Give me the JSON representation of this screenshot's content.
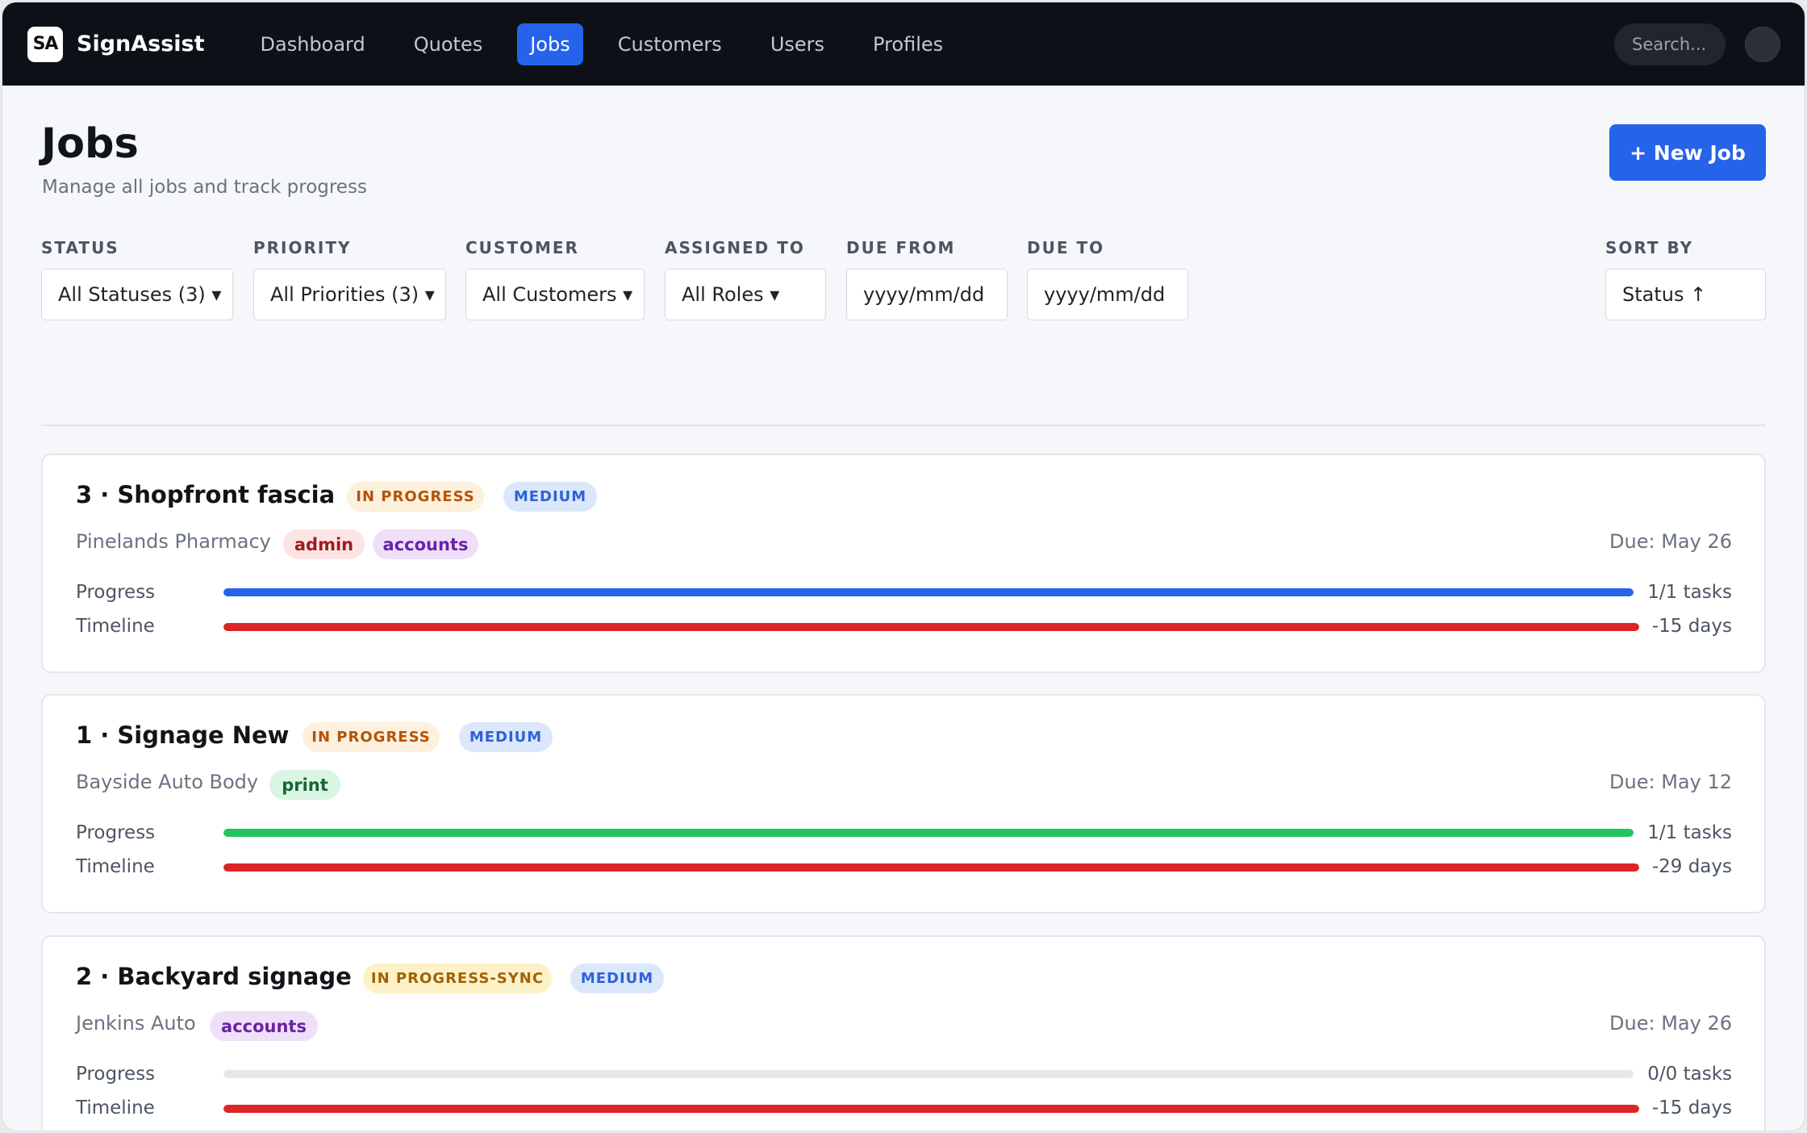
{
  "app": {
    "logo_badge": "SA",
    "name": "SignAssist"
  },
  "nav": {
    "items": [
      {
        "label": "Dashboard",
        "active": false
      },
      {
        "label": "Quotes",
        "active": false
      },
      {
        "label": "Jobs",
        "active": true
      },
      {
        "label": "Customers",
        "active": false
      },
      {
        "label": "Users",
        "active": false
      },
      {
        "label": "Profiles",
        "active": false
      }
    ],
    "search_placeholder": "Search..."
  },
  "page": {
    "title": "Jobs",
    "subtitle": "Manage all jobs and track progress",
    "new_job_label": "+ New Job"
  },
  "filters": {
    "status": {
      "label": "STATUS",
      "value": "All Statuses (3) ▾"
    },
    "priority": {
      "label": "PRIORITY",
      "value": "All Priorities (3) ▾"
    },
    "customer": {
      "label": "CUSTOMER",
      "value": "All Customers ▾"
    },
    "assigned": {
      "label": "ASSIGNED TO",
      "value": "All Roles ▾"
    },
    "due_from": {
      "label": "DUE FROM",
      "value": "yyyy/mm/dd"
    },
    "due_to": {
      "label": "DUE TO",
      "value": "yyyy/mm/dd"
    },
    "sort": {
      "label": "SORT BY",
      "value": "Status ↑"
    }
  },
  "labels": {
    "progress": "Progress",
    "timeline": "Timeline"
  },
  "colors": {
    "accent": "#2563eb",
    "progress_blue": "#2563eb",
    "progress_green": "#22c55e",
    "timeline_red": "#dc2626"
  },
  "jobs": [
    {
      "title": "3 · Shopfront fascia",
      "status": "IN PROGRESS",
      "priority": "MEDIUM",
      "customer": "Pinelands Pharmacy",
      "tags": [
        "admin",
        "accounts"
      ],
      "due": "Due: May 26",
      "progress_text": "1/1 tasks",
      "progress_fraction": 1.0,
      "timeline_text": "-15 days",
      "timeline_fraction": 1.0
    },
    {
      "title": "1 · Signage New",
      "status": "IN PROGRESS",
      "priority": "MEDIUM",
      "customer": "Bayside Auto Body",
      "tags": [
        "print"
      ],
      "due": "Due: May 12",
      "progress_text": "1/1 tasks",
      "progress_fraction": 1.0,
      "timeline_text": "-29 days",
      "timeline_fraction": 1.0
    },
    {
      "title": "2 · Backyard signage",
      "status": "IN PROGRESS-SYNC",
      "priority": "MEDIUM",
      "customer": "Jenkins Auto",
      "tags": [
        "accounts"
      ],
      "due": "Due: May 26",
      "progress_text": "0/0 tasks",
      "progress_fraction": 0.0,
      "timeline_text": "-15 days",
      "timeline_fraction": 1.0
    }
  ]
}
